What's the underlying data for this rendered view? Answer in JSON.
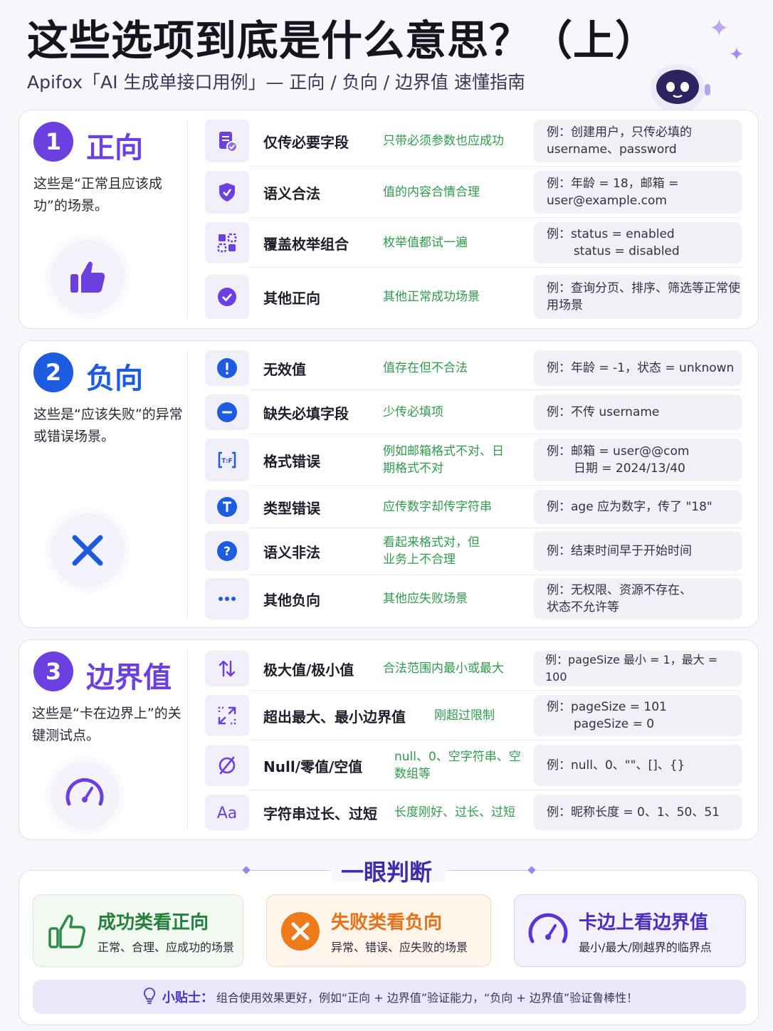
{
  "header": {
    "title": "这些选项到底是什么意思？（上）",
    "subtitle": "Apifox「AI 生成单接口用例」— 正向 / 负向 / 边界值 速懂指南"
  },
  "colors": {
    "positive": "#6b3fe0",
    "negative": "#1d5be0",
    "boundary": "#6b3fe0",
    "desc_green": "#2f9b4d",
    "orange": "#ef7a1a"
  },
  "sections": [
    {
      "num": "1",
      "name": "正向",
      "desc": "这些是“正常且应该成功”的场景。",
      "badge_icon": "thumbs-up-icon",
      "rows": [
        {
          "icon": "document-check-icon",
          "name": "仅传必要字段",
          "desc": "只带必须参数也应成功",
          "example": "例：创建用户，只传必填的 username、password"
        },
        {
          "icon": "shield-check-icon",
          "name": "语义合法",
          "desc": "值的内容合情合理",
          "example": "例：年龄 = 18，邮箱 = user@example.com"
        },
        {
          "icon": "grid-combination-icon",
          "name": "覆盖枚举组合",
          "desc": "枚举值都试一遍",
          "example": "例：status = enabled\n       status = disabled"
        },
        {
          "icon": "check-circle-icon",
          "name": "其他正向",
          "desc": "其他正常成功场景",
          "example": "例：查询分页、排序、筛选等正常使用场景"
        }
      ]
    },
    {
      "num": "2",
      "name": "负向",
      "desc": "这些是“应该失败”的异常或错误场景。",
      "badge_icon": "cross-icon",
      "rows": [
        {
          "icon": "exclamation-icon",
          "name": "无效值",
          "desc": "值存在但不合法",
          "example": "例：年龄 = -1，状态 = unknown"
        },
        {
          "icon": "minus-circle-icon",
          "name": "缺失必填字段",
          "desc": "少传必填项",
          "example": "例：不传 username"
        },
        {
          "icon": "format-icon",
          "name": "格式错误",
          "desc": "例如邮箱格式不对、日期格式不对",
          "example": "例：邮箱 = user@@com\n       日期 = 2024/13/40"
        },
        {
          "icon": "type-t-icon",
          "name": "类型错误",
          "desc": "应传数字却传字符串",
          "example": "例：age 应为数字，传了 \"18\""
        },
        {
          "icon": "question-icon",
          "name": "语义非法",
          "desc": "看起来格式对，但业务上不合理",
          "example": "例：结束时间早于开始时间"
        },
        {
          "icon": "more-dots-icon",
          "name": "其他负向",
          "desc": "其他应失败场景",
          "example": "例：无权限、资源不存在、状态不允许等"
        }
      ]
    },
    {
      "num": "3",
      "name": "边界值",
      "desc": "这些是“卡在边界上”的关键测试点。",
      "badge_icon": "gauge-icon",
      "rows": [
        {
          "icon": "up-down-arrows-icon",
          "name": "极大值/极小值",
          "desc": "合法范围内最小或最大",
          "example": "例：pageSize 最小 = 1，最大 = 100"
        },
        {
          "icon": "expand-arrows-icon",
          "name": "超出最大、最小边界值",
          "desc": "刚超过限制",
          "example": "例：pageSize = 101\n       pageSize = 0"
        },
        {
          "icon": "null-icon",
          "name": "Null/零值/空值",
          "desc": "null、0、空字符串、空数组等",
          "example": "例：null、0、\"\"、[]、{}"
        },
        {
          "icon": "text-aa-icon",
          "name": "字符串过长、过短",
          "desc": "长度刚好、过长、过短",
          "example": "例：昵称长度 = 0、1、50、51"
        }
      ]
    }
  ],
  "summary": {
    "title": "一眼判断",
    "cards": [
      {
        "title": "成功类看正向",
        "sub": "正常、合理、应成功的场景",
        "icon": "thumbs-up-icon"
      },
      {
        "title": "失败类看负向",
        "sub": "异常、错误、应失败的场景",
        "icon": "cross-circle-icon"
      },
      {
        "title": "卡边上看边界值",
        "sub": "最小/最大/刚越界的临界点",
        "icon": "gauge-icon"
      }
    ],
    "tip_label": "小贴士：",
    "tip_text": "组合使用效果更好，例如“正向 + 边界值”验证能力，“负向 + 边界值”验证鲁棒性！"
  }
}
